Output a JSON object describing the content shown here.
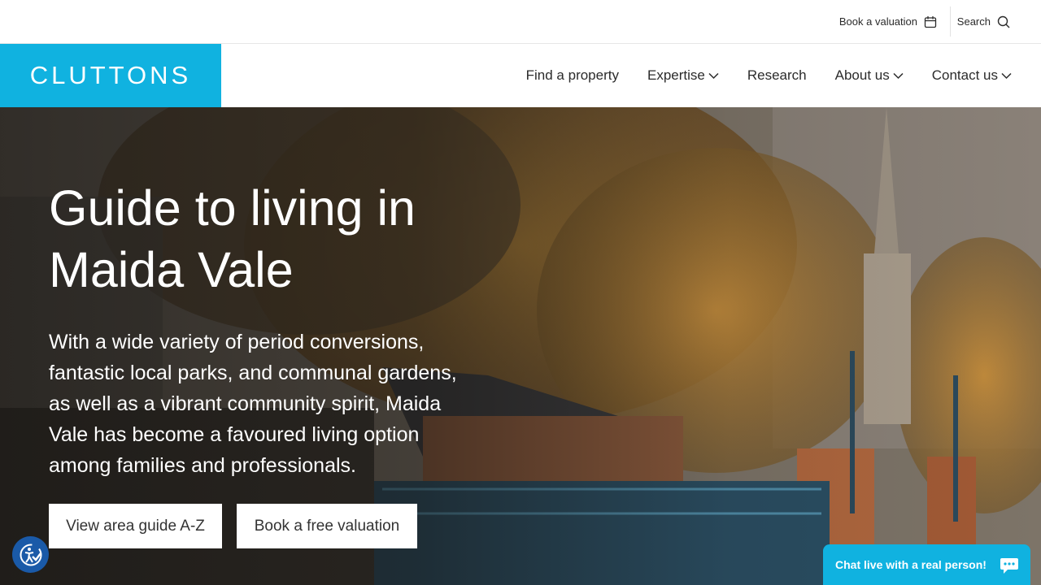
{
  "utility": {
    "valuation_label": "Book a valuation",
    "search_label": "Search",
    "calendar_icon": "calendar-icon",
    "search_icon": "search-icon"
  },
  "header": {
    "logo_text": "CLUTTONS",
    "brand_color": "#10b2e0"
  },
  "nav": {
    "items": [
      {
        "label": "Find a property",
        "dropdown": false
      },
      {
        "label": "Expertise",
        "dropdown": true
      },
      {
        "label": "Research",
        "dropdown": false
      },
      {
        "label": "About us",
        "dropdown": true
      },
      {
        "label": "Contact us",
        "dropdown": true
      }
    ]
  },
  "hero": {
    "title": "Guide to living in Maida Vale",
    "description": "With a wide variety of period conversions, fantastic local parks, and communal gardens, as well as a vibrant community spirit, Maida Vale has become a favoured living option among families and professionals.",
    "button_guide": "View area guide A-Z",
    "button_valuation": "Book a free valuation"
  },
  "chat": {
    "label": "Chat live with a real person!",
    "icon": "chat-bubble-icon"
  },
  "accessibility": {
    "icon": "accessibility-icon"
  }
}
